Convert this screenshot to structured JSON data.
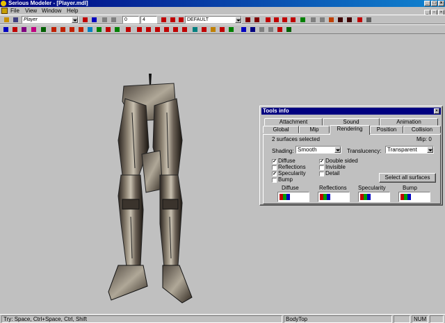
{
  "window": {
    "title": "Serious Modeler - [Player.mdl]",
    "title_bar_color": "#000080"
  },
  "menu": [
    {
      "label": "File"
    },
    {
      "label": "View"
    },
    {
      "label": "Window"
    },
    {
      "label": "Help"
    }
  ],
  "toolbar": {
    "model_combo": "Player",
    "frame_start": "0",
    "frame_step": "4",
    "skin_combo": "DEFAULT"
  },
  "viewport": {
    "background_color": "#c0c0c0",
    "model": "Player legs mesh, metallic"
  },
  "tools_info": {
    "title": "Tools info",
    "tabs_row1": [
      {
        "label": "Attachment"
      },
      {
        "label": "Sound"
      },
      {
        "label": "Animation"
      }
    ],
    "tabs_row2": [
      {
        "label": "Global"
      },
      {
        "label": "Mip"
      },
      {
        "label": "Rendering",
        "active": true
      },
      {
        "label": "Position"
      },
      {
        "label": "Collision"
      }
    ],
    "selection_text": "2 surfaces selected",
    "mip_text": "Mip: 0",
    "shading_label": "Shading:",
    "shading_value": "Smooth",
    "translucency_label": "Translucency:",
    "translucency_value": "Transparent",
    "checkboxes_left": [
      {
        "label": "Diffuse",
        "checked": true
      },
      {
        "label": "Reflections",
        "checked": false
      },
      {
        "label": "Specularity",
        "checked": true
      },
      {
        "label": "Bump",
        "checked": false
      }
    ],
    "checkboxes_right": [
      {
        "label": "Double sided",
        "checked": true
      },
      {
        "label": "Invisible",
        "checked": false
      },
      {
        "label": "Detail",
        "checked": false
      }
    ],
    "select_all_button": "Select all surfaces",
    "color_groups": [
      {
        "label": "Diffuse"
      },
      {
        "label": "Reflections"
      },
      {
        "label": "Specularity"
      },
      {
        "label": "Bump"
      }
    ]
  },
  "status": {
    "hint": "Try: Space, Ctrl+Space, Ctrl, Shift",
    "surface": "BodyTop",
    "num": "NUM"
  }
}
